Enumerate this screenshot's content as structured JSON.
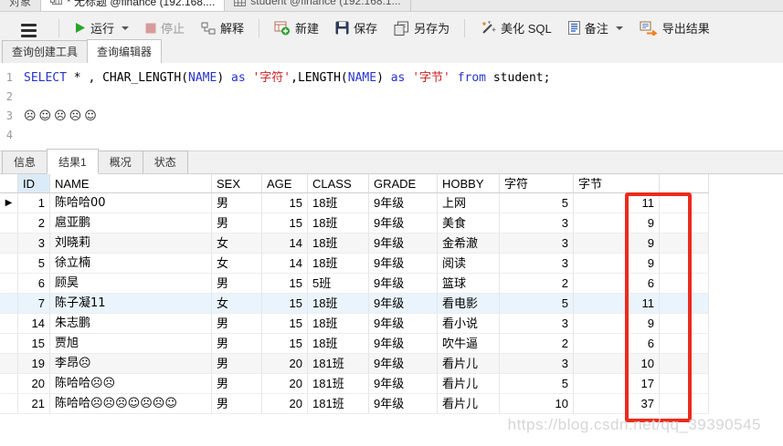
{
  "window_tabs": [
    {
      "label": "对象",
      "icon": null,
      "active": false
    },
    {
      "label": "* 无标题 @finance (192.168....",
      "icon": "query-grid-icon",
      "active": true
    },
    {
      "label": "student @finance (192.168.1...",
      "icon": "table-grid-icon",
      "active": false
    }
  ],
  "toolbar": {
    "items": [
      {
        "type": "menu",
        "icon": "hamburger-icon"
      },
      {
        "type": "sep"
      },
      {
        "type": "button",
        "label": "运行",
        "icon": "run-play-icon",
        "caret": true,
        "disabled": false
      },
      {
        "type": "button",
        "label": "停止",
        "icon": "stop-icon",
        "caret": false,
        "disabled": true
      },
      {
        "type": "button",
        "label": "解释",
        "icon": "explain-icon",
        "caret": false,
        "disabled": false
      },
      {
        "type": "sep"
      },
      {
        "type": "button",
        "label": "新建",
        "icon": "new-query-icon",
        "caret": false,
        "disabled": false
      },
      {
        "type": "button",
        "label": "保存",
        "icon": "save-icon",
        "caret": false,
        "disabled": false
      },
      {
        "type": "button",
        "label": "另存为",
        "icon": "save-as-icon",
        "caret": false,
        "disabled": false
      },
      {
        "type": "sep"
      },
      {
        "type": "button",
        "label": "美化 SQL",
        "icon": "beautify-wand-icon",
        "caret": false,
        "disabled": false
      },
      {
        "type": "button",
        "label": "备注",
        "icon": "comment-doc-icon",
        "caret": true,
        "disabled": false
      },
      {
        "type": "button",
        "label": "导出结果",
        "icon": "export-icon",
        "caret": false,
        "disabled": false
      }
    ]
  },
  "editor_tabs": [
    {
      "label": "查询创建工具",
      "active": false
    },
    {
      "label": "查询编辑器",
      "active": true
    }
  ],
  "editor": {
    "lines": [
      {
        "num": "1",
        "tokens": [
          {
            "t": "SELECT",
            "c": "kw"
          },
          {
            "t": " * , CHAR_LENGTH(",
            "c": "plain"
          },
          {
            "t": "NAME",
            "c": "kw"
          },
          {
            "t": ") ",
            "c": "plain"
          },
          {
            "t": "as",
            "c": "kw"
          },
          {
            "t": " ",
            "c": "plain"
          },
          {
            "t": "'字符'",
            "c": "str"
          },
          {
            "t": ",LENGTH(",
            "c": "plain"
          },
          {
            "t": "NAME",
            "c": "kw"
          },
          {
            "t": ") ",
            "c": "plain"
          },
          {
            "t": "as",
            "c": "kw"
          },
          {
            "t": " ",
            "c": "plain"
          },
          {
            "t": "'字节'",
            "c": "str"
          },
          {
            "t": " ",
            "c": "plain"
          },
          {
            "t": "from",
            "c": "kw"
          },
          {
            "t": " student;",
            "c": "plain"
          }
        ]
      },
      {
        "num": "2",
        "tokens": []
      },
      {
        "num": "3",
        "tokens": [
          {
            "t": "☹☺☹☹☺",
            "c": "emoji"
          }
        ]
      },
      {
        "num": "4",
        "tokens": []
      }
    ]
  },
  "result_tabs": [
    {
      "label": "信息",
      "active": false
    },
    {
      "label": "结果1",
      "active": true
    },
    {
      "label": "概况",
      "active": false
    },
    {
      "label": "状态",
      "active": false
    }
  ],
  "grid": {
    "columns": [
      "ID",
      "NAME",
      "SEX",
      "AGE",
      "CLASS",
      "GRADE",
      "HOBBY",
      "字符",
      "字节"
    ],
    "rows": [
      {
        "marker": true,
        "bg": null,
        "cells": [
          "1",
          "陈哈哈00",
          "男",
          "15",
          "18班",
          "9年级",
          "上网",
          "5",
          "11"
        ]
      },
      {
        "marker": false,
        "bg": null,
        "cells": [
          "2",
          "扈亚鹏",
          "男",
          "15",
          "18班",
          "9年级",
          "美食",
          "3",
          "9"
        ]
      },
      {
        "marker": false,
        "bg": "gray",
        "cells": [
          "3",
          "刘晓莉",
          "女",
          "14",
          "18班",
          "9年级",
          "金希澈",
          "3",
          "9"
        ]
      },
      {
        "marker": false,
        "bg": null,
        "cells": [
          "5",
          "徐立楠",
          "女",
          "14",
          "18班",
          "9年级",
          "阅读",
          "3",
          "9"
        ]
      },
      {
        "marker": false,
        "bg": null,
        "cells": [
          "6",
          "顾昊",
          "男",
          "15",
          "5班",
          "9年级",
          "篮球",
          "2",
          "6"
        ]
      },
      {
        "marker": false,
        "bg": "blue",
        "cells": [
          "7",
          "陈子凝11",
          "女",
          "15",
          "18班",
          "9年级",
          "看电影",
          "5",
          "11"
        ]
      },
      {
        "marker": false,
        "bg": null,
        "cells": [
          "14",
          "朱志鹏",
          "男",
          "15",
          "18班",
          "9年级",
          "看小说",
          "3",
          "9"
        ]
      },
      {
        "marker": false,
        "bg": null,
        "cells": [
          "15",
          "贾旭",
          "男",
          "15",
          "18班",
          "9年级",
          "吹牛逼",
          "2",
          "6"
        ]
      },
      {
        "marker": false,
        "bg": "gray",
        "cells": [
          "19",
          "李昂☹",
          "男",
          "20",
          "181班",
          "9年级",
          "看片儿",
          "3",
          "10"
        ]
      },
      {
        "marker": false,
        "bg": null,
        "cells": [
          "20",
          "陈哈哈☹☹",
          "男",
          "20",
          "181班",
          "9年级",
          "看片儿",
          "5",
          "17"
        ]
      },
      {
        "marker": false,
        "bg": null,
        "cells": [
          "21",
          "陈哈哈☹☹☹☺☹☹☺",
          "男",
          "20",
          "181班",
          "9年级",
          "看片儿",
          "10",
          "37"
        ]
      }
    ]
  },
  "watermark": "https://blog.csdn.net/qq_39390545",
  "colors": {
    "run_green": "#27a527",
    "stop_pink": "#d89a9a",
    "export_orange": "#f08020",
    "keyword_blue": "#2733cc",
    "string_red": "#cc2222",
    "annotation_red": "#ec2b1c",
    "id_header_blue": "#dcebf8",
    "selected_row_blue": "#eaf4fc"
  }
}
